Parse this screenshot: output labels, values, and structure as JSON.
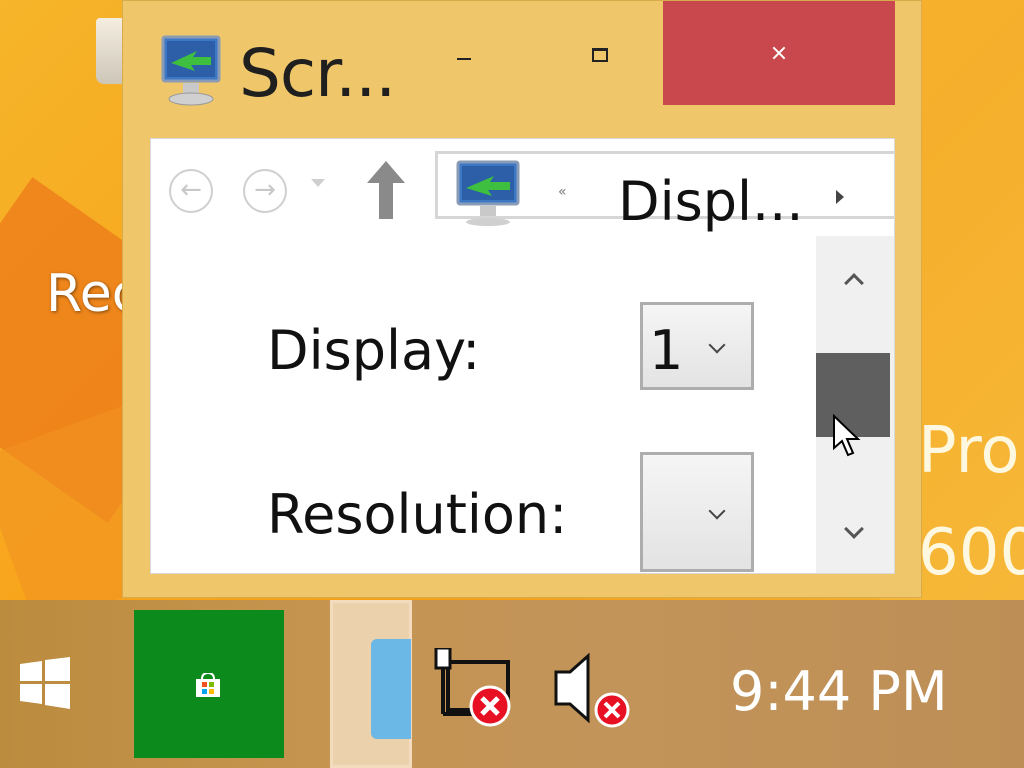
{
  "desktop": {
    "label_partial": "Rec",
    "bg_text_1": "Pro",
    "bg_text_2": "600"
  },
  "window": {
    "title": "Scr...",
    "icon": "monitor-icon",
    "controls": {
      "minimize": "minimize-icon",
      "maximize": "maximize-icon",
      "close": "close-icon",
      "close_color": "#c9484d"
    }
  },
  "navigation": {
    "back_glyph": "←",
    "forward_glyph": "→",
    "address": {
      "separator": "«",
      "location": "Displ..."
    }
  },
  "settings": {
    "display_label": "Display:",
    "display_value": "1",
    "resolution_label": "Resolution:",
    "resolution_value": ""
  },
  "taskbar": {
    "store_color": "#0c8a1b",
    "clock": "9:44 PM"
  },
  "colors": {
    "window_frame": "#efc76a",
    "scroll_thumb": "#5f5f5f"
  }
}
